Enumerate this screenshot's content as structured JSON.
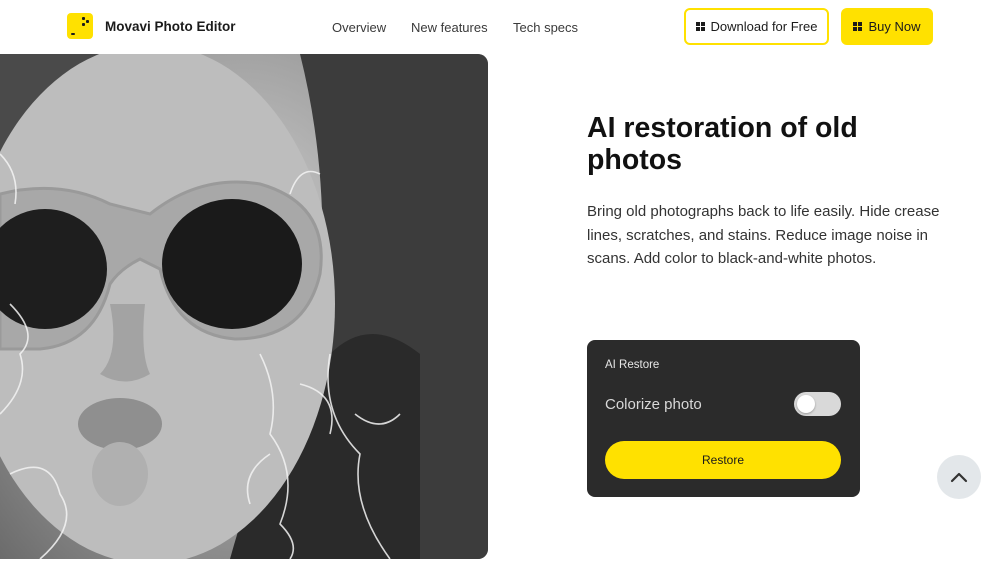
{
  "header": {
    "brand": "Movavi Photo Editor",
    "nav": [
      {
        "label": "Overview"
      },
      {
        "label": "New features"
      },
      {
        "label": "Tech specs"
      }
    ],
    "download_label": "Download for Free",
    "buy_label": "Buy Now"
  },
  "hero": {
    "title": "AI restoration of old photos",
    "description": "Bring old photographs back to life easily. Hide crease lines, scratches, and stains. Reduce image noise in scans. Add color to black-and-white photos."
  },
  "panel": {
    "title": "AI Restore",
    "colorize_label": "Colorize photo",
    "colorize_on": false,
    "restore_label": "Restore"
  },
  "icons": {
    "logo": "movavi-logo-icon",
    "windows": "windows-icon",
    "scroll_top": "chevron-up-icon"
  },
  "colors": {
    "accent": "#ffe100",
    "panel_bg": "#2b2b2b",
    "text": "#1b1b1b"
  }
}
